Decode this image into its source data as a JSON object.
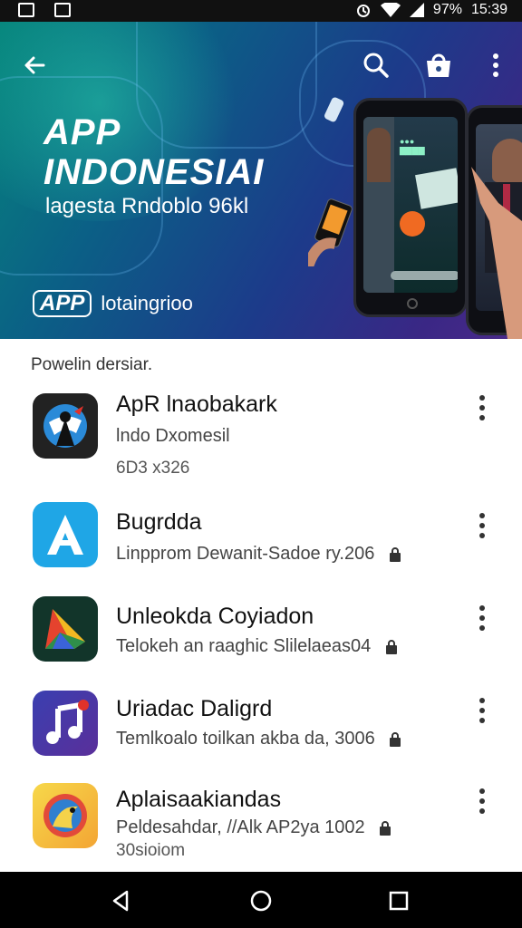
{
  "status_bar": {
    "battery": "97%",
    "time": "15:39"
  },
  "hero": {
    "title_line1": "APP",
    "title_line2": "INDONESIAI",
    "subtitle": "lagesta Rndoblo 96kl",
    "brand_logo": "APP",
    "brand_text": "lotaingrioo"
  },
  "section_label": "Powelin dersiar.",
  "apps": [
    {
      "name": "ApR lnaobakark",
      "line1": "lndo Dxomesil",
      "line2": "6D3 x326",
      "icon": "compass-app-icon"
    },
    {
      "name": "Bugrdda",
      "line1": "Linpprom Dewanit-Sadoe ry.206",
      "icon": "letter-a-app-icon"
    },
    {
      "name": "Unleokda Coyiadon",
      "line1": "Telokeh an raaghic Slilelaeas04",
      "icon": "triangle-app-icon"
    },
    {
      "name": "Uriadac Daligrd",
      "line1": "Temlkoalo toilkan akba da, 3006",
      "icon": "music-app-icon"
    },
    {
      "name": "Aplaisaakiandas",
      "line1": "Peldesahdar, //Alk AP2ya 1002",
      "line2": "30sioiom",
      "icon": "bird-app-icon"
    }
  ],
  "colors": {
    "hero_start": "#06857c",
    "hero_end": "#4b2a8a"
  }
}
